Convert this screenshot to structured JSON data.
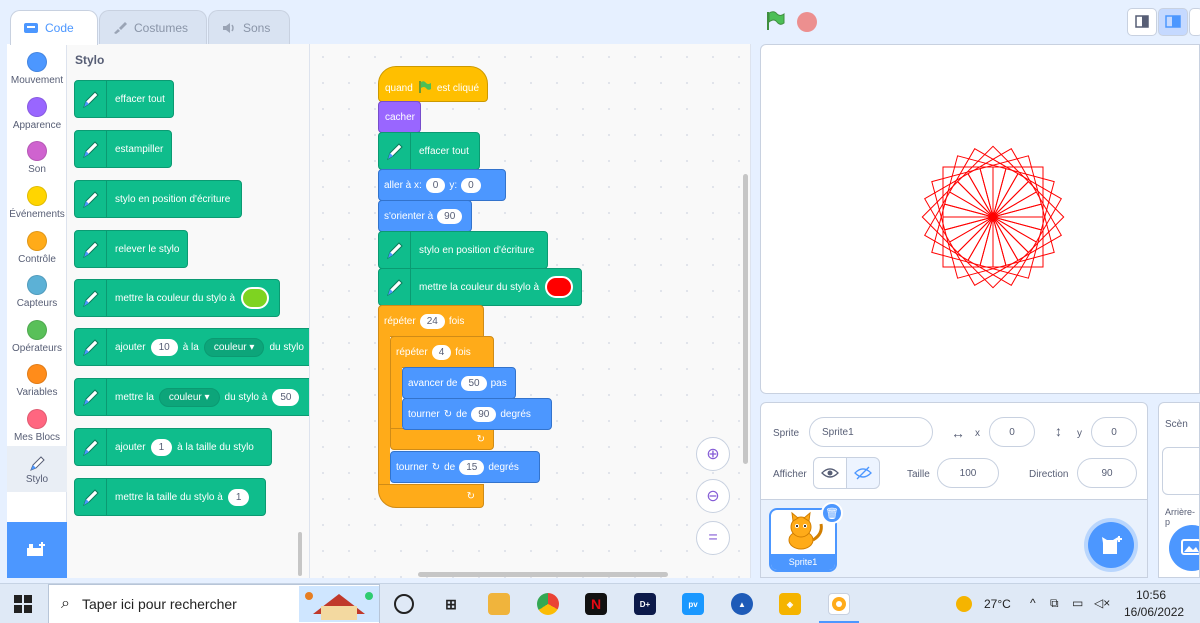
{
  "tabs": [
    {
      "label": "Code",
      "active": true
    },
    {
      "label": "Costumes",
      "active": false
    },
    {
      "label": "Sons",
      "active": false
    }
  ],
  "categories": [
    {
      "label": "Mouvement",
      "color": "#4c97ff"
    },
    {
      "label": "Apparence",
      "color": "#9966ff"
    },
    {
      "label": "Son",
      "color": "#cf63cf"
    },
    {
      "label": "Événements",
      "color": "#ffd500"
    },
    {
      "label": "Contrôle",
      "color": "#ffab19"
    },
    {
      "label": "Capteurs",
      "color": "#5cb1d6"
    },
    {
      "label": "Opérateurs",
      "color": "#59c059"
    },
    {
      "label": "Variables",
      "color": "#ff8c1a"
    },
    {
      "label": "Mes Blocs",
      "color": "#ff6680"
    },
    {
      "label": "Stylo",
      "color": "#0fbd8c"
    }
  ],
  "palette": {
    "title": "Stylo",
    "blocks": {
      "clear": "effacer tout",
      "stamp": "estampiller",
      "pen_down": "stylo en position d'écriture",
      "pen_up": "relever le stylo",
      "set_color": "mettre la couleur du stylo à",
      "set_color_value": "#7ed321",
      "change_pre": "ajouter",
      "change_value": "10",
      "change_mid": "à la",
      "change_dropdown": "couleur",
      "change_post": "du stylo",
      "set_param_pre": "mettre la",
      "set_param_dropdown": "couleur",
      "set_param_mid": "du stylo à",
      "set_param_value": "50",
      "change_size_pre": "ajouter",
      "change_size_value": "1",
      "change_size_post": "à la taille du stylo",
      "set_size": "mettre la taille du stylo à",
      "set_size_value": "1"
    }
  },
  "script": {
    "hat_pre": "quand",
    "hat_post": "est cliqué",
    "hide": "cacher",
    "clear": "effacer tout",
    "goto_pre": "aller à x:",
    "goto_x": "0",
    "goto_y_label": "y:",
    "goto_y": "0",
    "point": "s'orienter à",
    "point_value": "90",
    "pen_down": "stylo en position d'écriture",
    "set_color": "mettre la couleur du stylo à",
    "set_color_value": "#ff0000",
    "repeat_outer": "répéter",
    "repeat_outer_value": "24",
    "repeat_outer_post": "fois",
    "repeat_inner": "répéter",
    "repeat_inner_value": "4",
    "repeat_inner_post": "fois",
    "move_pre": "avancer de",
    "move_value": "50",
    "move_post": "pas",
    "turn_inner_pre": "tourner",
    "turn_inner_mid": "de",
    "turn_inner_value": "90",
    "turn_inner_post": "degrés",
    "turn_outer_pre": "tourner",
    "turn_outer_mid": "de",
    "turn_outer_value": "15",
    "turn_outer_post": "degrés"
  },
  "zoom_reset": "=",
  "stage_drawing": {
    "squares": 24,
    "step_degrees": 15,
    "side": 50,
    "color": "#ff0000"
  },
  "sprite_info": {
    "sprite_label": "Sprite",
    "sprite_name": "Sprite1",
    "x_label": "x",
    "x_value": "0",
    "y_label": "y",
    "y_value": "0",
    "show_label": "Afficher",
    "size_label": "Taille",
    "size_value": "100",
    "direction_label": "Direction",
    "direction_value": "90"
  },
  "sprite_list": [
    {
      "name": "Sprite1",
      "selected": true
    }
  ],
  "scene_pane": {
    "title": "Scèn",
    "backdrop_label": "Arrière-p"
  },
  "taskbar": {
    "search_placeholder": "Taper ici pour rechercher",
    "weather": "27°C",
    "time": "10:56",
    "date": "16/06/2022"
  }
}
